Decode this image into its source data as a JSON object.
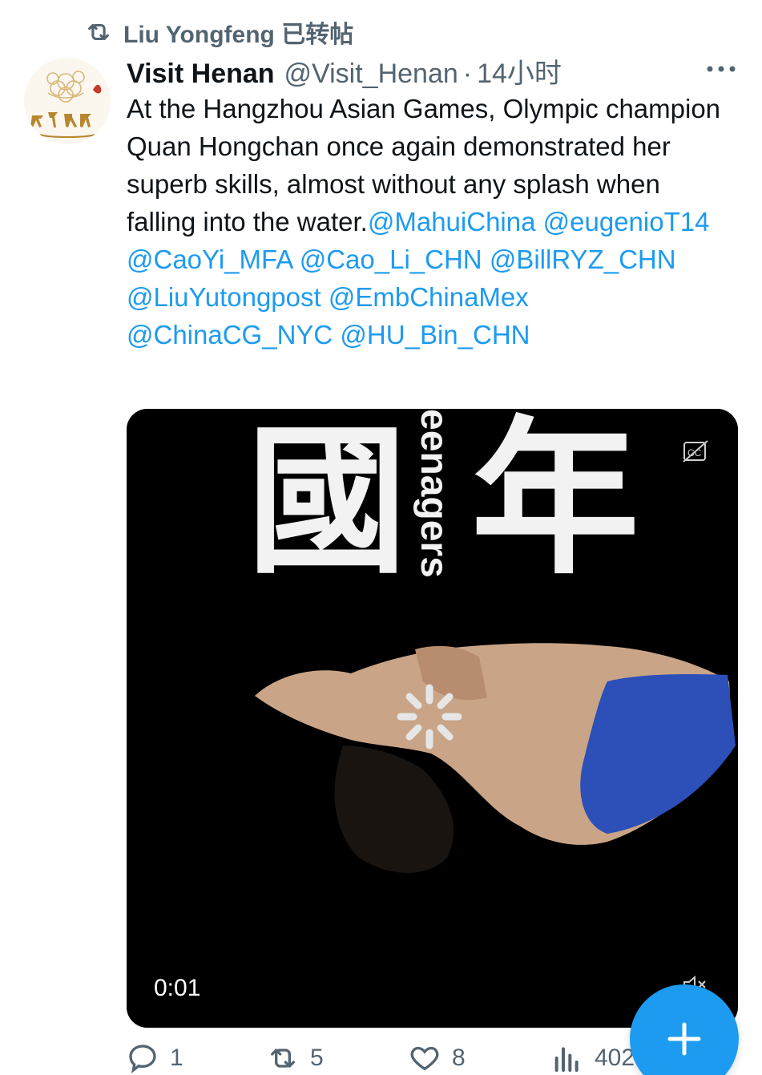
{
  "retweet": {
    "icon": "retweet-icon",
    "text": "Liu Yongfeng 已转帖"
  },
  "tweet": {
    "display_name": "Visit Henan",
    "handle": "@Visit_Henan",
    "separator": "·",
    "time": "14小时",
    "text_body": "At the Hangzhou Asian Games, Olympic champion Quan Hongchan once again demonstrated her superb skills, almost without any splash when falling into the water.",
    "mentions": [
      "@MahuiChina",
      "@eugenioT14",
      "@CaoYi_MFA",
      "@Cao_Li_CHN",
      "@BillRYZ_CHN",
      "@LiuYutongpost",
      "@EmbChinaMex",
      "@ChinaCG_NYC",
      "@HU_Bin_CHN"
    ]
  },
  "media": {
    "overlay_chars": [
      "國",
      "年"
    ],
    "vertical_text": "eenagers",
    "timestamp": "0:01"
  },
  "actions": {
    "reply_count": "1",
    "retweet_count": "5",
    "like_count": "8",
    "views_count": "402"
  },
  "colors": {
    "accent": "#1d9bf0",
    "muted": "#536471",
    "text": "#0f1419",
    "media_bg": "#000000",
    "swimsuit": "#2c4fb8"
  }
}
